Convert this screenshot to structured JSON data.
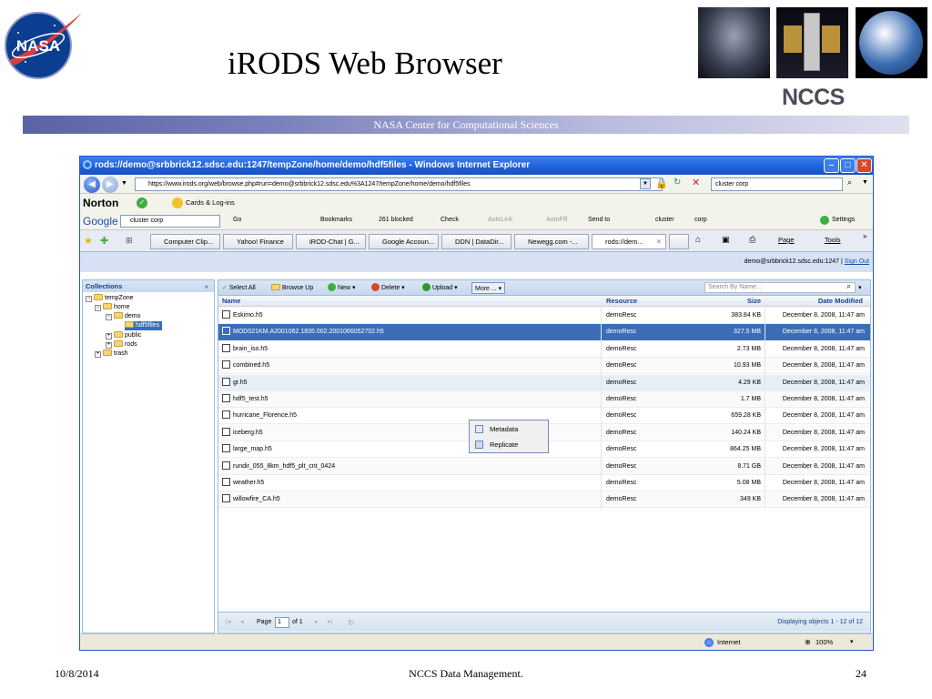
{
  "slide": {
    "title": "iRODS Web Browser",
    "org_label": "NCCS",
    "band_text": "NASA Center for Computational Sciences",
    "footer_date": "10/8/2014",
    "footer_center": "NCCS Data Management.",
    "footer_page": "24"
  },
  "logo": {
    "text": "NASA"
  },
  "browser": {
    "window_title": "rods://demo@srbbrick12.sdsc.edu:1247/tempZone/home/demo/hdf5files - Windows Internet Explorer",
    "url": "https://www.irods.org/web/browse.php#ruri=demo@srbbrick12.sdsc.edu%3A1247/tempZone/home/demo/hdf5files",
    "search_value": "cluster corp",
    "norton_label": "Norton",
    "norton_cards": "Cards & Log-ins",
    "google_label": "Google",
    "google_query": "cluster corp",
    "google_items": [
      "Go",
      "Bookmarks",
      "261 blocked",
      "Check",
      "AutoLink",
      "AutoFill",
      "Send to",
      "cluster",
      "corp"
    ],
    "google_settings": "Settings",
    "tabs": [
      "Computer Clip...",
      "Yahoo! Finance",
      "iROD-Chat | G...",
      "Google Accoun...",
      "DDN | DataDir...",
      "Newegg.com -...",
      "rods://dem..."
    ],
    "page_menu": "Page",
    "tools_menu": "Tools",
    "user_text": "demo@srbbrick12.sdsc.edu:1247",
    "sign_out": "Sign Out",
    "status_zone": "Internet",
    "zoom": "100%"
  },
  "tree": {
    "header": "Collections",
    "nodes": [
      "tempZone",
      "home",
      "demo",
      "hdf5files",
      "public",
      "rods",
      "trash"
    ]
  },
  "toolbar": {
    "select_all": "Select All",
    "browse_up": "Browse Up",
    "new": "New",
    "delete": "Delete",
    "upload": "Upload",
    "more": "More ...",
    "search_placeholder": "Search By Name..."
  },
  "menu": {
    "items": [
      "Metadata",
      "Replicate"
    ]
  },
  "table": {
    "columns": [
      "Name",
      "Resource",
      "Size",
      "Date Modified"
    ],
    "rows": [
      {
        "name": "Eskimo.h5",
        "resource": "demoResc",
        "size": "383.84 KB",
        "date": "December 8, 2008, 11:47 am"
      },
      {
        "name": "MOD021KM.A2001062.1835.002.2001066052702.h5",
        "resource": "demoResc",
        "size": "327.5 MB",
        "date": "December 8, 2008, 11:47 am"
      },
      {
        "name": "brain_iso.h5",
        "resource": "demoResc",
        "size": "2.73 MB",
        "date": "December 8, 2008, 11:47 am"
      },
      {
        "name": "combined.h5",
        "resource": "demoResc",
        "size": "10.93 MB",
        "date": "December 8, 2008, 11:47 am"
      },
      {
        "name": "gr.h5",
        "resource": "demoResc",
        "size": "4.29 KB",
        "date": "December 8, 2008, 11:47 am"
      },
      {
        "name": "hdf5_test.h5",
        "resource": "demoResc",
        "size": "1.7 MB",
        "date": "December 8, 2008, 11:47 am"
      },
      {
        "name": "hurricane_Florence.h5",
        "resource": "demoResc",
        "size": "659.28 KB",
        "date": "December 8, 2008, 11:47 am"
      },
      {
        "name": "iceberg.h5",
        "resource": "demoResc",
        "size": "140.24 KB",
        "date": "December 8, 2008, 11:47 am"
      },
      {
        "name": "large_map.h5",
        "resource": "demoResc",
        "size": "864.25 MB",
        "date": "December 8, 2008, 11:47 am"
      },
      {
        "name": "rundir_055_8km_hdf5_plt_cnt_0424",
        "resource": "demoResc",
        "size": "8.71 GB",
        "date": "December 8, 2008, 11:47 am"
      },
      {
        "name": "weather.h5",
        "resource": "demoResc",
        "size": "5.08 MB",
        "date": "December 8, 2008, 11:47 am"
      },
      {
        "name": "willowfire_CA.h5",
        "resource": "demoResc",
        "size": "349 KB",
        "date": "December 8, 2008, 11:47 am"
      }
    ]
  },
  "pager": {
    "page_label": "Page",
    "page_value": "1",
    "of_label": "of 1",
    "summary": "Displaying objects 1 - 12 of 12"
  },
  "colors": {
    "accent": "#1f5ed9",
    "selection": "#3c6db8",
    "band": "#6d73b3"
  }
}
